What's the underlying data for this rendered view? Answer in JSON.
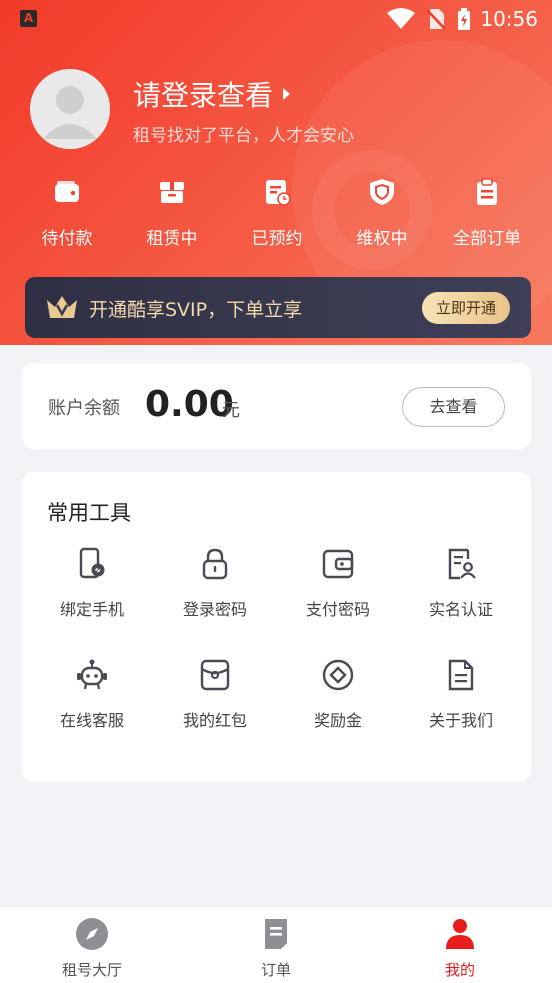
{
  "status_bar": {
    "time": "10:56",
    "app_icon_letter": "A"
  },
  "profile": {
    "title": "请登录查看",
    "subtitle": "租号找对了平台，人才会安心"
  },
  "order_shortcuts": [
    {
      "label": "待付款",
      "icon": "wallet-icon"
    },
    {
      "label": "租赁中",
      "icon": "box-icon"
    },
    {
      "label": "已预约",
      "icon": "reservation-icon"
    },
    {
      "label": "维权中",
      "icon": "shield-icon"
    },
    {
      "label": "全部订单",
      "icon": "clipboard-icon"
    }
  ],
  "vip": {
    "text": "开通酷享SVIP，下单立享",
    "button": "立即开通"
  },
  "balance": {
    "label": "账户余额",
    "amount": "0.00",
    "unit": "元",
    "button": "去查看"
  },
  "tools": {
    "title": "常用工具",
    "items": [
      {
        "label": "绑定手机",
        "icon": "phone-link-icon"
      },
      {
        "label": "登录密码",
        "icon": "lock-icon"
      },
      {
        "label": "支付密码",
        "icon": "wallet-card-icon"
      },
      {
        "label": "实名认证",
        "icon": "id-doc-icon"
      },
      {
        "label": "在线客服",
        "icon": "robot-icon"
      },
      {
        "label": "我的红包",
        "icon": "red-packet-icon"
      },
      {
        "label": "奖励金",
        "icon": "coin-icon"
      },
      {
        "label": "关于我们",
        "icon": "document-icon"
      }
    ]
  },
  "tabbar": {
    "items": [
      {
        "label": "租号大厅",
        "icon": "compass-icon"
      },
      {
        "label": "订单",
        "icon": "order-doc-icon"
      },
      {
        "label": "我的",
        "icon": "user-icon"
      }
    ],
    "active_index": 2
  },
  "colors": {
    "accent": "#e81c1c",
    "header_start": "#f23a2a",
    "header_end": "#f7795f",
    "vip_bg": "#2f2f44",
    "vip_gold": "#f2d9a8"
  }
}
